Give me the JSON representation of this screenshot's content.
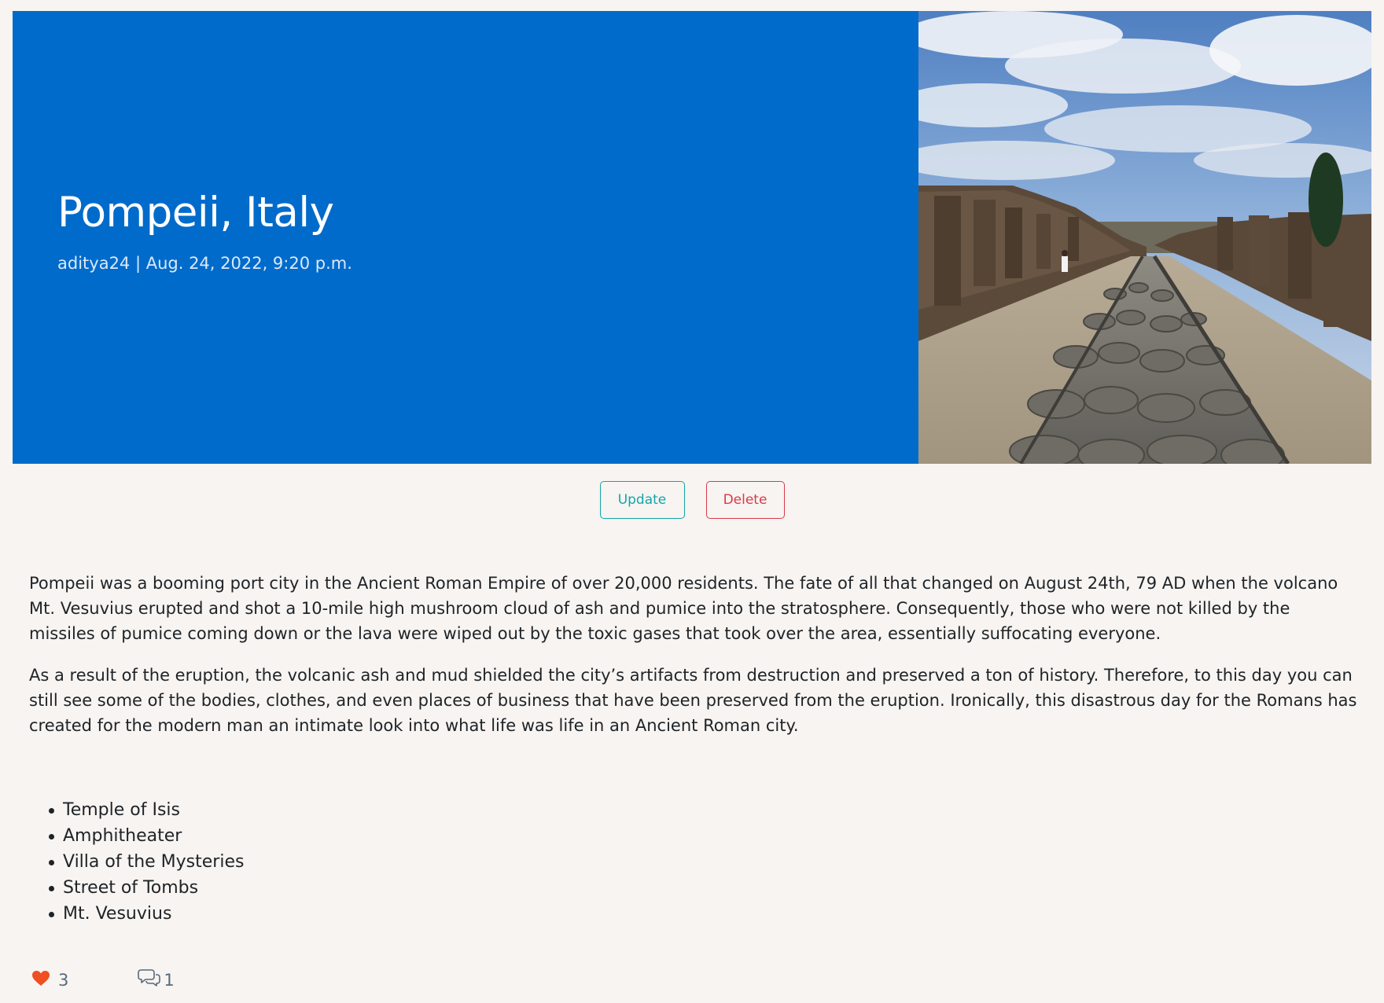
{
  "post": {
    "title": "Pompeii, Italy",
    "meta": "aditya24 | Aug. 24, 2022, 9:20 p.m."
  },
  "actions": {
    "update_label": "Update",
    "delete_label": "Delete"
  },
  "body": {
    "paragraphs": [
      "Pompeii was a booming port city in the Ancient Roman Empire of over 20,000 residents. The fate of all that changed on August 24th, 79 AD when the volcano Mt. Vesuvius erupted and shot a 10-mile high mushroom cloud of ash and pumice into the stratosphere. Consequently, those who were not killed by the missiles of pumice coming down or the lava were wiped out by the toxic gases that took over the area, essentially suffocating everyone.",
      "As a result of the eruption, the volcanic ash and mud shielded the city’s artifacts from destruction and preserved a ton of history. Therefore, to this day you can still see some of the bodies, clothes, and even places of business that have been preserved from the eruption. Ironically, this disastrous day for the Romans has created for the modern man an intimate look into what life was life in an Ancient Roman city."
    ],
    "places": [
      "Temple of Isis",
      "Amphitheater",
      "Villa of the Mysteries",
      "Street of Tombs",
      "Mt. Vesuvius"
    ]
  },
  "stats": {
    "likes": "3",
    "comments": "1"
  },
  "icons": {
    "like": "heart-icon",
    "comment": "comment-bubbles-icon"
  },
  "colors": {
    "hero_background": "#006bcb",
    "update_accent": "#12a6a5",
    "delete_accent": "#d93a4a",
    "heart": "#f04e23",
    "page_background": "#f7f4f2"
  }
}
